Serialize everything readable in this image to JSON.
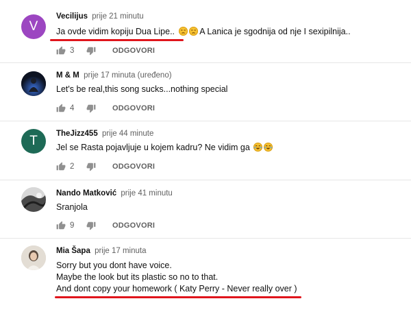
{
  "comments": [
    {
      "author": "Vecilijus",
      "time": "prije 21 minutu",
      "avatar_letter": "V",
      "avatar_color": "#9c46c1",
      "lines": [
        "Ja ovde vidim kopiju Dua Lipe..",
        "A Lanica je sgodnija od nje I sexipilnija.."
      ],
      "likes": "3",
      "reply_label": "ODGOVORI"
    },
    {
      "author": "M & M",
      "time": "prije 17 minuta (uređeno)",
      "lines": [
        "Let's be real,this song sucks...nothing special"
      ],
      "likes": "4",
      "reply_label": "ODGOVORI"
    },
    {
      "author": "TheJizz455",
      "time": "prije 44 minute",
      "avatar_letter": "T",
      "avatar_color": "#1e6a56",
      "lines": [
        "Jel se Rasta pojavljuje u kojem kadru? Ne vidim ga"
      ],
      "likes": "2",
      "reply_label": "ODGOVORI"
    },
    {
      "author": "Nando Matković",
      "time": "prije 41 minutu",
      "lines": [
        "Sranjola"
      ],
      "likes": "9",
      "reply_label": "ODGOVORI"
    },
    {
      "author": "Mia Šapa",
      "time": "prije 17 minuta",
      "lines": [
        "Sorry but you dont have voice.",
        "Maybe the look but its plastic so no to that.",
        "And dont copy your homework ( Katy Perry - Never really over )"
      ]
    }
  ],
  "colors": {
    "underline": "#e0151c",
    "emoji": "#f6c131"
  }
}
